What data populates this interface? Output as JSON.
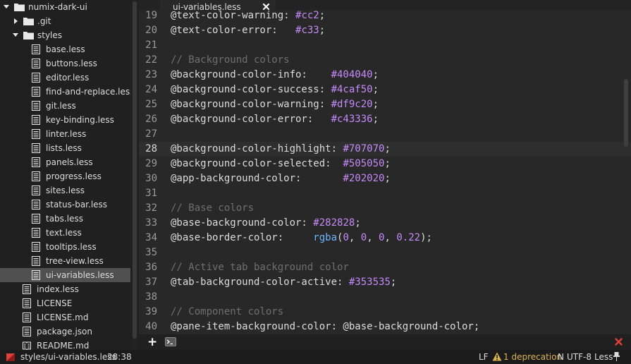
{
  "tree": {
    "items": [
      {
        "label": "numix-dark-ui",
        "kind": "folder",
        "expanded": true,
        "depth": 0,
        "selected": false
      },
      {
        "label": ".git",
        "kind": "folder",
        "expanded": false,
        "depth": 1,
        "selected": false
      },
      {
        "label": "styles",
        "kind": "folder",
        "expanded": true,
        "depth": 1,
        "selected": false
      },
      {
        "label": "base.less",
        "kind": "file",
        "depth": 2,
        "selected": false
      },
      {
        "label": "buttons.less",
        "kind": "file",
        "depth": 2,
        "selected": false
      },
      {
        "label": "editor.less",
        "kind": "file",
        "depth": 2,
        "selected": false
      },
      {
        "label": "find-and-replace.less",
        "kind": "file",
        "depth": 2,
        "selected": false
      },
      {
        "label": "git.less",
        "kind": "file",
        "depth": 2,
        "selected": false
      },
      {
        "label": "key-binding.less",
        "kind": "file",
        "depth": 2,
        "selected": false
      },
      {
        "label": "linter.less",
        "kind": "file",
        "depth": 2,
        "selected": false
      },
      {
        "label": "lists.less",
        "kind": "file",
        "depth": 2,
        "selected": false
      },
      {
        "label": "panels.less",
        "kind": "file",
        "depth": 2,
        "selected": false
      },
      {
        "label": "progress.less",
        "kind": "file",
        "depth": 2,
        "selected": false
      },
      {
        "label": "sites.less",
        "kind": "file",
        "depth": 2,
        "selected": false
      },
      {
        "label": "status-bar.less",
        "kind": "file",
        "depth": 2,
        "selected": false
      },
      {
        "label": "tabs.less",
        "kind": "file",
        "depth": 2,
        "selected": false
      },
      {
        "label": "text.less",
        "kind": "file",
        "depth": 2,
        "selected": false
      },
      {
        "label": "tooltips.less",
        "kind": "file",
        "depth": 2,
        "selected": false
      },
      {
        "label": "tree-view.less",
        "kind": "file",
        "depth": 2,
        "selected": false
      },
      {
        "label": "ui-variables.less",
        "kind": "file",
        "depth": 2,
        "selected": true
      },
      {
        "label": "index.less",
        "kind": "file",
        "depth": 1,
        "selected": false
      },
      {
        "label": "LICENSE",
        "kind": "file",
        "depth": 1,
        "selected": false
      },
      {
        "label": "LICENSE.md",
        "kind": "file",
        "depth": 1,
        "selected": false
      },
      {
        "label": "package.json",
        "kind": "file",
        "depth": 1,
        "selected": false
      },
      {
        "label": "README.md",
        "kind": "readme",
        "depth": 1,
        "selected": false
      }
    ]
  },
  "tabs": [
    {
      "title": "ui-variables.less",
      "active": true
    }
  ],
  "editor": {
    "cursor_line": 28,
    "lines": [
      {
        "num": "19",
        "tokens": [
          {
            "t": "@text-color-warning: ",
            "c": ""
          },
          {
            "t": "#cc2",
            "c": "color"
          },
          {
            "t": ";",
            "c": ""
          }
        ]
      },
      {
        "num": "20",
        "tokens": [
          {
            "t": "@text-color-error:   ",
            "c": ""
          },
          {
            "t": "#c33",
            "c": "color"
          },
          {
            "t": ";",
            "c": ""
          }
        ]
      },
      {
        "num": "21",
        "tokens": []
      },
      {
        "num": "22",
        "tokens": [
          {
            "t": "// Background colors",
            "c": "comment"
          }
        ]
      },
      {
        "num": "23",
        "tokens": [
          {
            "t": "@background-color-info:    ",
            "c": ""
          },
          {
            "t": "#404040",
            "c": "color"
          },
          {
            "t": ";",
            "c": ""
          }
        ]
      },
      {
        "num": "24",
        "tokens": [
          {
            "t": "@background-color-success: ",
            "c": ""
          },
          {
            "t": "#4caf50",
            "c": "color"
          },
          {
            "t": ";",
            "c": ""
          }
        ]
      },
      {
        "num": "25",
        "tokens": [
          {
            "t": "@background-color-warning: ",
            "c": ""
          },
          {
            "t": "#df9c20",
            "c": "color"
          },
          {
            "t": ";",
            "c": ""
          }
        ]
      },
      {
        "num": "26",
        "tokens": [
          {
            "t": "@background-color-error:   ",
            "c": ""
          },
          {
            "t": "#c43336",
            "c": "color"
          },
          {
            "t": ";",
            "c": ""
          }
        ]
      },
      {
        "num": "27",
        "tokens": []
      },
      {
        "num": "28",
        "tokens": [
          {
            "t": "@background-color-highlight: ",
            "c": ""
          },
          {
            "t": "#707070",
            "c": "color"
          },
          {
            "t": ";",
            "c": ""
          }
        ]
      },
      {
        "num": "29",
        "tokens": [
          {
            "t": "@background-color-selected:  ",
            "c": ""
          },
          {
            "t": "#505050",
            "c": "color"
          },
          {
            "t": ";",
            "c": ""
          }
        ]
      },
      {
        "num": "30",
        "tokens": [
          {
            "t": "@app-background-color:       ",
            "c": ""
          },
          {
            "t": "#202020",
            "c": "color"
          },
          {
            "t": ";",
            "c": ""
          }
        ]
      },
      {
        "num": "31",
        "tokens": []
      },
      {
        "num": "32",
        "tokens": [
          {
            "t": "// Base colors",
            "c": "comment"
          }
        ]
      },
      {
        "num": "33",
        "tokens": [
          {
            "t": "@base-background-color: ",
            "c": ""
          },
          {
            "t": "#282828",
            "c": "color"
          },
          {
            "t": ";",
            "c": ""
          }
        ]
      },
      {
        "num": "34",
        "tokens": [
          {
            "t": "@base-border-color:     ",
            "c": ""
          },
          {
            "t": "rgba",
            "c": "func"
          },
          {
            "t": "(",
            "c": ""
          },
          {
            "t": "0",
            "c": "num"
          },
          {
            "t": ", ",
            "c": ""
          },
          {
            "t": "0",
            "c": "num"
          },
          {
            "t": ", ",
            "c": ""
          },
          {
            "t": "0",
            "c": "num"
          },
          {
            "t": ", ",
            "c": ""
          },
          {
            "t": "0.22",
            "c": "num"
          },
          {
            "t": ");",
            "c": ""
          }
        ]
      },
      {
        "num": "35",
        "tokens": []
      },
      {
        "num": "36",
        "tokens": [
          {
            "t": "// Active tab background color",
            "c": "comment"
          }
        ]
      },
      {
        "num": "37",
        "tokens": [
          {
            "t": "@tab-background-color-active: ",
            "c": ""
          },
          {
            "t": "#353535",
            "c": "color"
          },
          {
            "t": ";",
            "c": ""
          }
        ]
      },
      {
        "num": "38",
        "tokens": []
      },
      {
        "num": "39",
        "tokens": [
          {
            "t": "// Component colors",
            "c": "comment"
          }
        ]
      },
      {
        "num": "40",
        "tokens": [
          {
            "t": "@pane-item-background-color: @base-background-color;",
            "c": ""
          }
        ]
      }
    ]
  },
  "panel": {
    "add_label": "+",
    "add_icon": "plus-icon",
    "terminal_icon": "terminal-icon",
    "close_icon": "close-icon"
  },
  "status": {
    "file_path": "styles/ui-variables.less",
    "cursor": "28:38",
    "line_ending": "LF",
    "deprecation": "1 deprecation",
    "n": "N",
    "encoding": "UTF-8",
    "grammar": "Less"
  },
  "colors": {
    "folder": "#e8e8e8",
    "warning": "#d9b34f",
    "error_red": "#e0403a",
    "selected_row": "#505050"
  }
}
